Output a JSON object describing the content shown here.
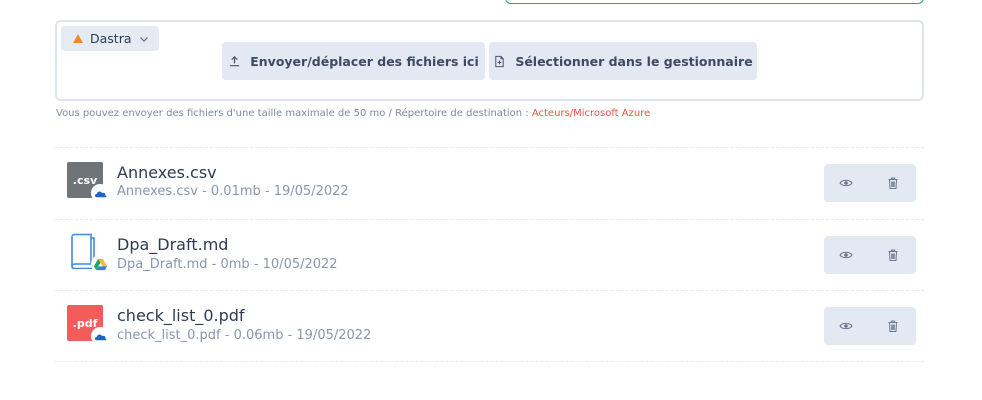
{
  "uploader": {
    "source": {
      "label": "Dastra",
      "icon": "dastra-triangle-icon",
      "color": "#f08a24"
    },
    "upload_label": "Envoyer/déplacer des fichiers ici",
    "select_label": "Sélectionner dans le gestionnaire",
    "help_text": "Vous pouvez envoyer des fichiers d'une taille maximale de 50 mo / Répertoire de destination : ",
    "destination": "Acteurs/Microsoft Azure"
  },
  "files": [
    {
      "name": "Annexes.csv",
      "meta": "Annexes.csv - 0.01mb - 19/05/2022",
      "icon": "csv-file-icon",
      "ext": ".csv",
      "color": "#6f7478",
      "storage": "onedrive-icon"
    },
    {
      "name": "Dpa_Draft.md",
      "meta": "Dpa_Draft.md - 0mb - 10/05/2022",
      "icon": "book-file-icon",
      "color": "#3d8ae0",
      "storage": "google-drive-icon"
    },
    {
      "name": "check_list_0.pdf",
      "meta": "check_list_0.pdf - 0.06mb - 19/05/2022",
      "icon": "pdf-file-icon",
      "ext": ".pdf",
      "color": "#f45b5b",
      "storage": "onedrive-icon"
    }
  ]
}
